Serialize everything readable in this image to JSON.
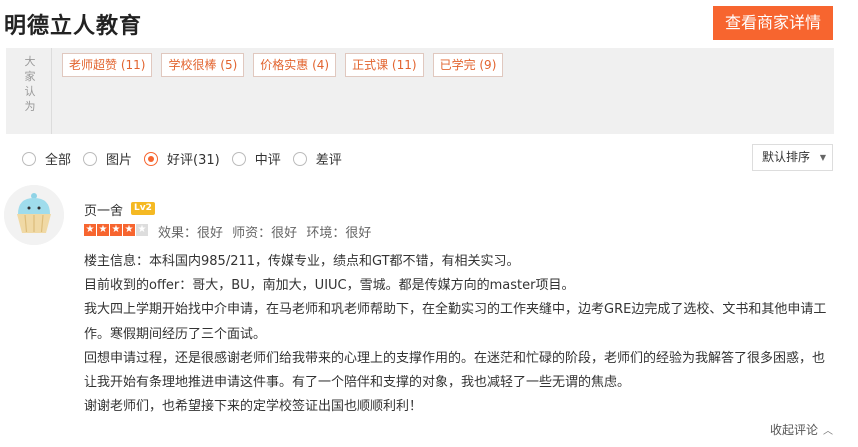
{
  "header": {
    "shop_name": "明德立人教育",
    "detail_button": "查看商家详情"
  },
  "tag_panel": {
    "side_label": "大家认为",
    "tags": [
      "老师超赞 (11)",
      "学校很棒 (5)",
      "价格实惠 (4)",
      "正式课 (11)",
      "已学完 (9)"
    ]
  },
  "filters": {
    "options": [
      "全部",
      "图片",
      "好评(31)",
      "中评",
      "差评"
    ],
    "selected": "好评(31)",
    "sort_label": "默认排序"
  },
  "review": {
    "username": "页一舍",
    "level": "Lv2",
    "rating": 4,
    "scores": [
      "效果：很好",
      "师资：很好",
      "环境：很好"
    ],
    "paragraphs": [
      "楼主信息：本科国内985/211，传媒专业，绩点和GT都不错，有相关实习。",
      "目前收到的offer：哥大，BU，南加大，UIUC，雪城。都是传媒方向的master项目。",
      "我大四上学期开始找中介申请，在马老师和巩老师帮助下，在全勤实习的工作夹缝中，边考GRE边完成了选校、文书和其他申请工作。寒假期间经历了三个面试。",
      "回想申请过程，还是很感谢老师们给我带来的心理上的支撑作用的。在迷茫和忙碌的阶段，老师们的经验为我解答了很多困惑，也让我开始有条理地推进申请这件事。有了一个陪伴和支撑的对象，我也减轻了一些无谓的焦虑。",
      "谢谢老师们，也希望接下来的定学校签证出国也顺顺利利！"
    ],
    "collapse_label": "收起评论"
  },
  "colors": {
    "accent": "#f7652f",
    "tag_text": "#e2642f",
    "panel_bg": "#f0f0f0",
    "badge": "#f5b923"
  }
}
